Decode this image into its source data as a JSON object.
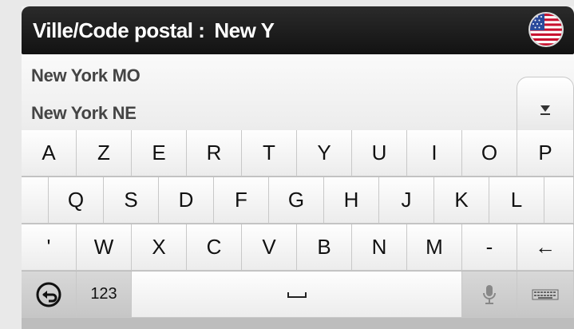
{
  "header": {
    "label": "Ville/Code postal :",
    "value": "New Y",
    "flag_icon": "us-flag-icon"
  },
  "results": [
    "New York MO",
    "New York NE"
  ],
  "scroll": {
    "icon": "scroll-down-icon",
    "glyph": "▼"
  },
  "keyboard": {
    "row1": [
      "A",
      "Z",
      "E",
      "R",
      "T",
      "Y",
      "U",
      "I",
      "O",
      "P"
    ],
    "row2": [
      "Q",
      "S",
      "D",
      "F",
      "G",
      "H",
      "J",
      "K",
      "L"
    ],
    "row3": [
      "'",
      "W",
      "X",
      "C",
      "V",
      "B",
      "N",
      "M",
      "-"
    ],
    "backspace_icon": "backspace-arrow-icon",
    "backspace_glyph": "←",
    "back_icon": "back-circle-icon",
    "numbers_label": "123",
    "space_icon": "space-bar-icon",
    "mic_icon": "microphone-icon",
    "layout_icon": "keyboard-layout-icon"
  },
  "colors": {
    "header_bg": "#1a1a1a",
    "key_bg": "#f7f7f7",
    "key_dark": "#cfcfcf"
  }
}
